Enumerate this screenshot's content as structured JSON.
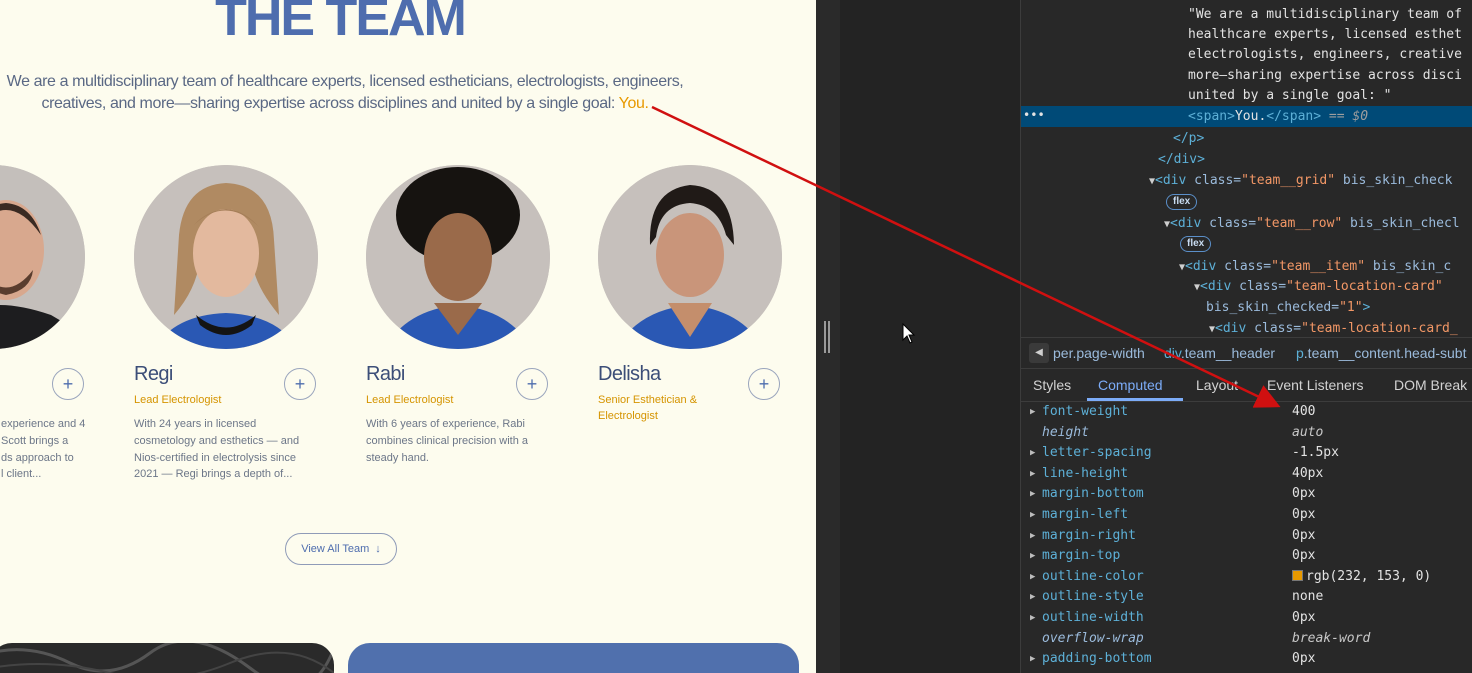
{
  "page": {
    "title": "THE TEAM",
    "intro": "We are a multidisciplinary team of healthcare experts, licensed estheticians, electrologists, engineers, creatives, and more—sharing expertise across disciplines and united by a single goal: ",
    "intro_highlight": "You.",
    "members": [
      {
        "name": "",
        "role": "",
        "bio": "experience and 4\nScott brings a\nds approach to\nl client..."
      },
      {
        "name": "Regi",
        "role": "Lead Electrologist",
        "bio": "With 24 years in licensed cosmetology and esthetics — and Nios-certified in electrolysis since 2021 — Regi brings a depth of..."
      },
      {
        "name": "Rabi",
        "role": "Lead Electrologist",
        "bio": "With 6 years of experience, Rabi combines clinical precision with a steady hand."
      },
      {
        "name": "Delisha",
        "role": "Senior Esthetician & Electrologist",
        "bio": ""
      }
    ],
    "plus_symbol": "+",
    "view_all_label": "View All Team",
    "view_all_icon": "↓"
  },
  "devtools": {
    "elements": {
      "text_line1": "\"We are a multidisciplinary team of",
      "text_line2": "healthcare experts, licensed esthet",
      "text_line3": "electrologists, engineers, creative",
      "text_line4": "more—sharing expertise across disci",
      "text_line5": "united by a single goal: \"",
      "selected_span_open": "<span>",
      "selected_span_text": "You.",
      "selected_span_close": "</span>",
      "selected_marker": " == $0",
      "dots": "•••",
      "p_close": "</p>",
      "div_close": "</div>",
      "team_grid_tag": "<div ",
      "team_grid_attr": "class=",
      "team_grid_val": "\"team__grid\"",
      "team_grid_rest": " bis_skin_check",
      "team_row_val": "\"team__row\"",
      "team_row_rest": " bis_skin_checl",
      "team_item_val": "\"team__item\"",
      "team_item_rest": " bis_skin_c",
      "loc_card_val": "\"team-location-card\"",
      "bis_attr": "bis_skin_checked=",
      "bis_val": "\"1\"",
      "loc_card2_val": "\"team-location-card_",
      "flex_badge": "flex"
    },
    "breadcrumbs": {
      "crumb1": "per.page-width",
      "crumb2_tag": "div",
      "crumb2_cls": ".team__header",
      "crumb3_tag": "p",
      "crumb3_cls": ".team__content.head-subt"
    },
    "tabs": [
      "Styles",
      "Computed",
      "Layout",
      "Event Listeners",
      "DOM Break"
    ],
    "active_tab": "Computed",
    "computed": [
      {
        "name": "font-weight",
        "value": "400"
      },
      {
        "name": "height",
        "value": "auto",
        "inherited": true
      },
      {
        "name": "letter-spacing",
        "value": "-1.5px"
      },
      {
        "name": "line-height",
        "value": "40px"
      },
      {
        "name": "margin-bottom",
        "value": "0px"
      },
      {
        "name": "margin-left",
        "value": "0px"
      },
      {
        "name": "margin-right",
        "value": "0px"
      },
      {
        "name": "margin-top",
        "value": "0px"
      },
      {
        "name": "outline-color",
        "value": "rgb(232, 153, 0)",
        "swatch": "#e89900"
      },
      {
        "name": "outline-style",
        "value": "none"
      },
      {
        "name": "outline-width",
        "value": "0px"
      },
      {
        "name": "overflow-wrap",
        "value": "break-word",
        "inherited": true
      },
      {
        "name": "padding-bottom",
        "value": "0px"
      }
    ]
  },
  "colors": {
    "page_bg": "#fdfcee",
    "brand_blue": "#4e6dae",
    "accent_gold": "#e89900",
    "devtools_bg": "#282828",
    "selection": "#004a77",
    "annotation_arrow": "#d01010"
  }
}
